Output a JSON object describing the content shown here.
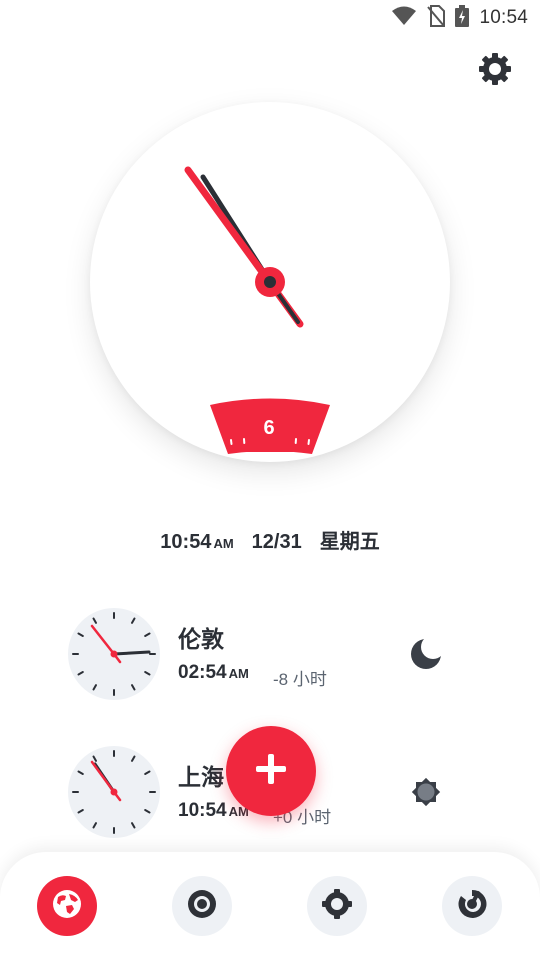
{
  "status_bar": {
    "time": "10:54",
    "icons": [
      "wifi-icon",
      "no-sim-icon",
      "battery-charging-icon"
    ]
  },
  "main_clock": {
    "hour": 10,
    "minute": 54,
    "dial_number": "6"
  },
  "date_line": {
    "time": "10:54",
    "ampm": "AM",
    "date": "12/31",
    "weekday": "星期五"
  },
  "cities": [
    {
      "name": "伦敦",
      "time": "02:54",
      "ampm": "AM",
      "offset": "-8 小时",
      "icon": "moon-icon",
      "hour": 2,
      "minute": 54
    },
    {
      "name": "上海",
      "time": "10:54",
      "ampm": "AM",
      "offset": "+0 小时",
      "icon": "sun-icon",
      "hour": 10,
      "minute": 54
    }
  ],
  "bottom_nav": {
    "items": [
      "world-clock-icon",
      "alarm-icon",
      "stopwatch-icon",
      "timer-icon"
    ],
    "active_index": 0
  },
  "colors": {
    "accent": "#f0273e",
    "text": "#2b2f36",
    "muted": "#5b6470",
    "chip": "#eef1f5"
  }
}
